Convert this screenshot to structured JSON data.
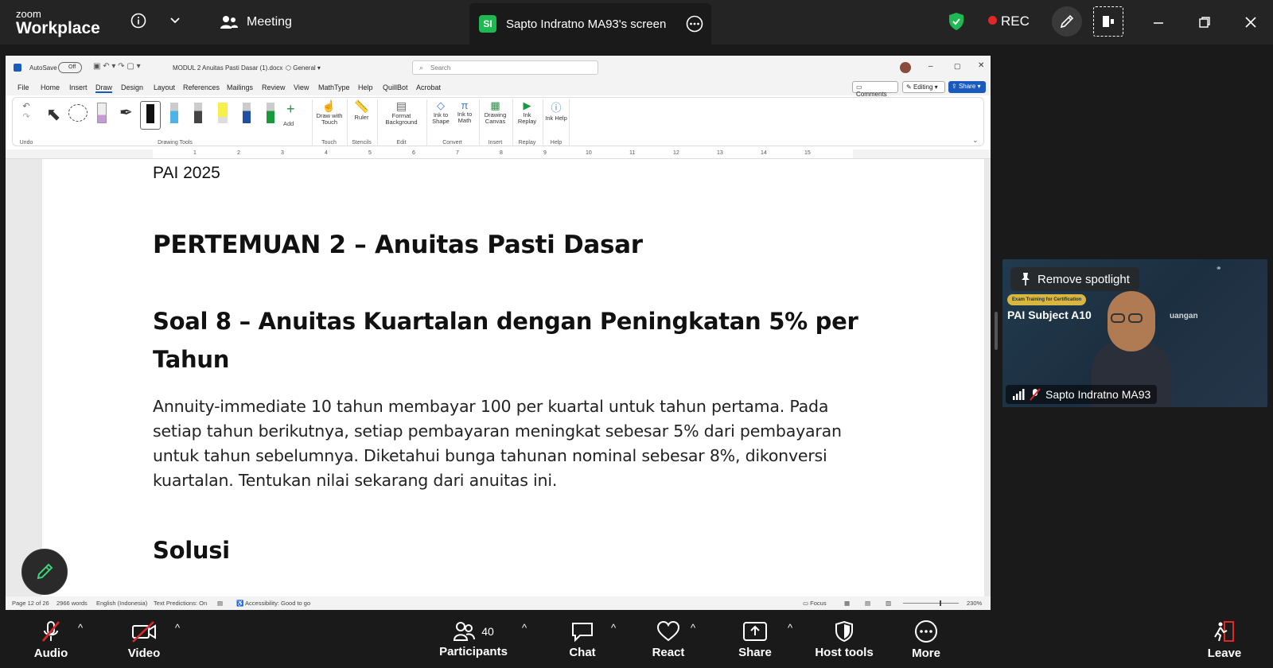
{
  "app": {
    "logo_top": "zoom",
    "logo_bottom": "Workplace",
    "meeting_label": "Meeting",
    "share_badge": "SI",
    "share_title": "Sapto Indratno MA93's screen",
    "rec_label": "REC"
  },
  "word": {
    "autosave": "AutoSave",
    "autosave_state": "Off",
    "filename": "MODUL 2 Anuitas Pasti Dasar (1).docx",
    "sensitivity": "General",
    "search_placeholder": "Search",
    "menu": [
      "File",
      "Home",
      "Insert",
      "Draw",
      "Design",
      "Layout",
      "References",
      "Mailings",
      "Review",
      "View",
      "MathType",
      "Help",
      "QuillBot",
      "Acrobat"
    ],
    "comments_label": "Comments",
    "editing_label": "Editing",
    "share_label": "Share",
    "ribbon": {
      "undo_group": "Undo",
      "drawing_tools_group": "Drawing Tools",
      "add_label": "Add",
      "draw_with_touch": "Draw with Touch",
      "touch_group": "Touch",
      "ruler": "Ruler",
      "stencils_group": "Stencils",
      "format_background": "Format Background",
      "edit_group": "Edit",
      "ink_to_shape": "Ink to Shape",
      "ink_to_math": "Ink to Math",
      "convert_group": "Convert",
      "drawing_canvas": "Drawing Canvas",
      "insert_group": "Insert",
      "ink_replay": "Ink Replay",
      "replay_group": "Replay",
      "ink_help": "Ink Help",
      "help_group": "Help"
    },
    "ruler_ticks": [
      "1",
      "2",
      "3",
      "4",
      "5",
      "6",
      "7",
      "8",
      "9",
      "10",
      "11",
      "12",
      "13",
      "14",
      "15"
    ],
    "doc": {
      "header": "PAI 2025",
      "title": "PERTEMUAN 2 – Anuitas Pasti Dasar",
      "soal_line1": "Soal 8 – Anuitas Kuartalan dengan Peningkatan 5% per",
      "soal_line2": "Tahun",
      "para_lines": [
        "Annuity-immediate 10 tahun membayar 100 per kuartal untuk tahun pertama. Pada",
        "setiap tahun berikutnya, setiap pembayaran meningkat sebesar 5% dari pembayaran",
        "untuk tahun sebelumnya. Diketahui bunga tahunan nominal sebesar 8%, dikonversi",
        "kuartalan. Tentukan nilai sekarang dari anuitas ini."
      ],
      "solusi": "Solusi"
    },
    "status": {
      "page": "Page 12 of 26",
      "words": "2966 words",
      "language": "English (Indonesia)",
      "predictions": "Text Predictions: On",
      "accessibility": "Accessibility: Good to go",
      "focus": "Focus",
      "zoom": "230%"
    }
  },
  "gallery": {
    "remove_spotlight": "Remove spotlight",
    "participant_name": "Sapto Indratno MA93",
    "slide_badge": "Exam Training for Certification",
    "slide_title": "PAI Subject A10",
    "slide_suffix": "uangan"
  },
  "toolbar": {
    "audio": "Audio",
    "video": "Video",
    "participants": "Participants",
    "participants_count": "40",
    "chat": "Chat",
    "react": "React",
    "share": "Share",
    "host_tools": "Host tools",
    "more": "More",
    "leave": "Leave"
  },
  "colors": {
    "zoom_bg": "#1a1a1a",
    "topbar": "#242424",
    "share_green": "#1fb954",
    "rec_red": "#e02828",
    "word_blue": "#185abd",
    "leave_red": "#e02828"
  }
}
